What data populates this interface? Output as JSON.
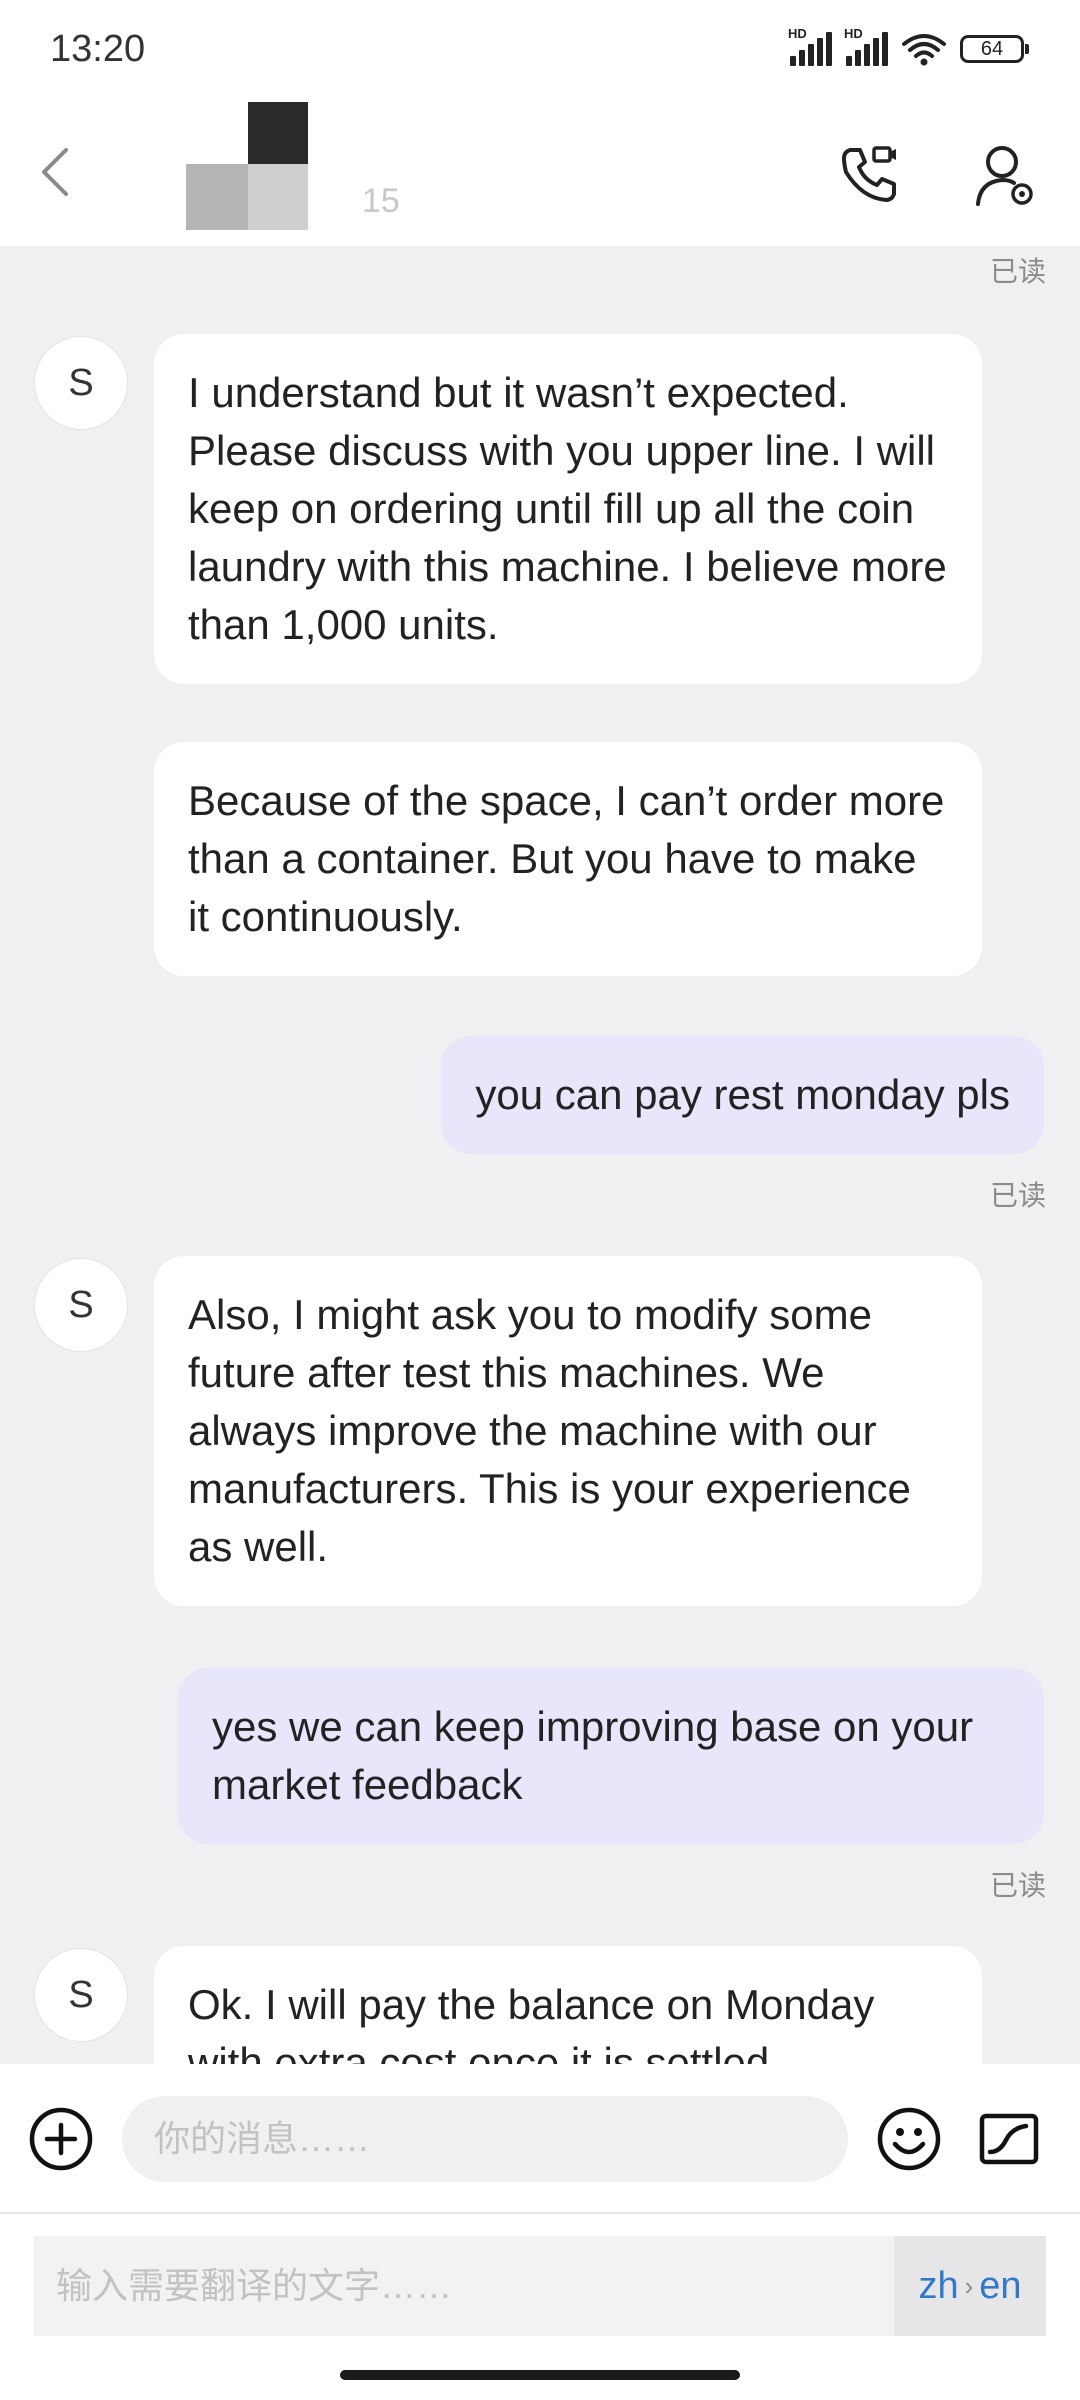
{
  "status_bar": {
    "time": "13:20",
    "signal1_label": "HD",
    "signal2_label": "HD",
    "battery": "64"
  },
  "header": {
    "title_fragment": "15",
    "back_icon": "chevron-left-icon",
    "call_icon": "video-call-icon",
    "profile_icon": "profile-settings-icon"
  },
  "chat": {
    "messages": [
      {
        "direction": "out",
        "read": "已读"
      },
      {
        "direction": "in",
        "avatar": "S",
        "text": "I understand but it wasn’t expected. Please discuss with you upper line. I will keep on ordering until fill up all the coin laundry with this machine. I believe more than 1,000 units."
      },
      {
        "direction": "in",
        "text": "Because of the space, I can’t order more than a container. But you have to make it continuously."
      },
      {
        "direction": "out",
        "text": "you can pay rest monday pls",
        "read": "已读"
      },
      {
        "direction": "in",
        "avatar": "S",
        "text": "Also, I might ask you to modify some future after test this machines. We always improve the machine with our manufacturers. This is your experience as well."
      },
      {
        "direction": "out",
        "text": "yes we can keep improving base on your market feedback",
        "read": "已读"
      },
      {
        "direction": "in",
        "avatar": "S",
        "text": "Ok. I will pay the balance on Monday with extra cost once it is settled."
      }
    ]
  },
  "input_bar": {
    "placeholder": "你的消息……",
    "plus_icon": "plus-circle-icon",
    "emoji_icon": "emoji-icon",
    "sticker_icon": "sticker-icon"
  },
  "translate": {
    "placeholder": "输入需要翻译的文字……",
    "from_lang": "zh",
    "arrow": "›",
    "to_lang": "en"
  },
  "colors": {
    "background": "#f0f0f3",
    "incoming_bubble": "#ffffff",
    "outgoing_bubble": "#e7e6fb",
    "lang_accent": "#3478c8"
  }
}
